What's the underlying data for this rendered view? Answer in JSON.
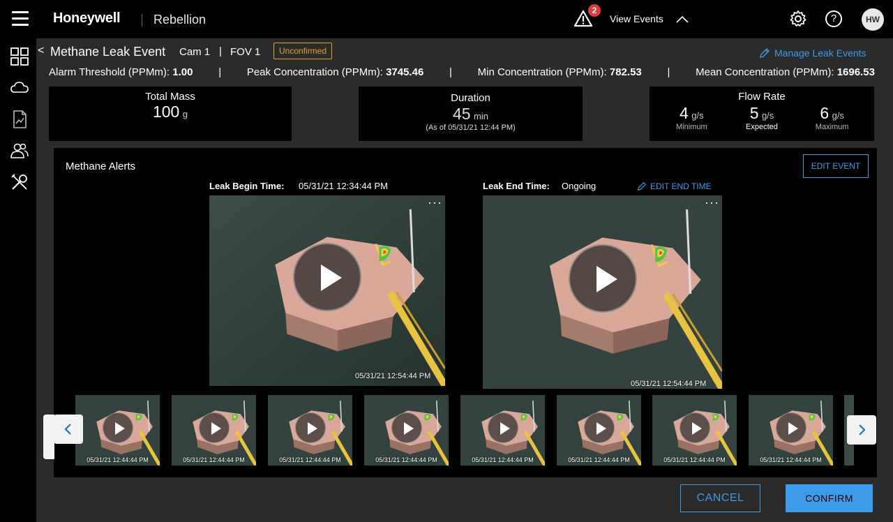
{
  "header": {
    "brand": "Honeywell",
    "app_name": "Rebellion",
    "alert_count": "2",
    "view_events": "View Events",
    "avatar_initials": "HW"
  },
  "event": {
    "back": "<",
    "title": "Methane Leak Event",
    "cam": "Cam 1",
    "separator": "|",
    "fov": "FOV 1",
    "status": "Unconfirmed",
    "manage_link": "Manage Leak Events"
  },
  "metrics": {
    "alarm_label": "Alarm Threshold  (PPMm):",
    "alarm_value": "1.00",
    "peak_label": "Peak Concentration (PPMm):",
    "peak_value": "3745.46",
    "min_label": "Min Concentration (PPMm):",
    "min_value": "782.53",
    "mean_label": "Mean Concentration (PPMm):",
    "mean_value": "1696.53"
  },
  "cards": {
    "mass": {
      "title": "Total Mass",
      "value": "100",
      "unit": "g"
    },
    "duration": {
      "title": "Duration",
      "value": "45",
      "unit": "min",
      "note": "(As of 05/31/21 12:44 PM)"
    },
    "flow": {
      "title": "Flow Rate",
      "items": [
        {
          "value": "4",
          "unit": "g/s",
          "label": "Minimum"
        },
        {
          "value": "5",
          "unit": "g/s",
          "label": "Expected"
        },
        {
          "value": "6",
          "unit": "g/s",
          "label": "Maximum"
        }
      ]
    }
  },
  "alerts": {
    "title": "Methane Alerts",
    "edit_event": "EDIT EVENT",
    "begin_label": "Leak  Begin Time:",
    "begin_value": "05/31/21 12:34:44 PM",
    "end_label": "Leak End Time:",
    "end_value": "Ongoing",
    "edit_end": "EDIT END TIME",
    "video1_ts": "05/31/21 12:54:44 PM",
    "video2_ts": "05/31/21 12:54:44 PM",
    "more": "···",
    "thumb_ts": "05/31/21 12:44:44 PM"
  },
  "footer": {
    "cancel": "CANCEL",
    "confirm": "CONFIRM"
  },
  "colors": {
    "accent": "#3d9be9",
    "warning": "#e0a52a",
    "badge": "#e0393e"
  }
}
